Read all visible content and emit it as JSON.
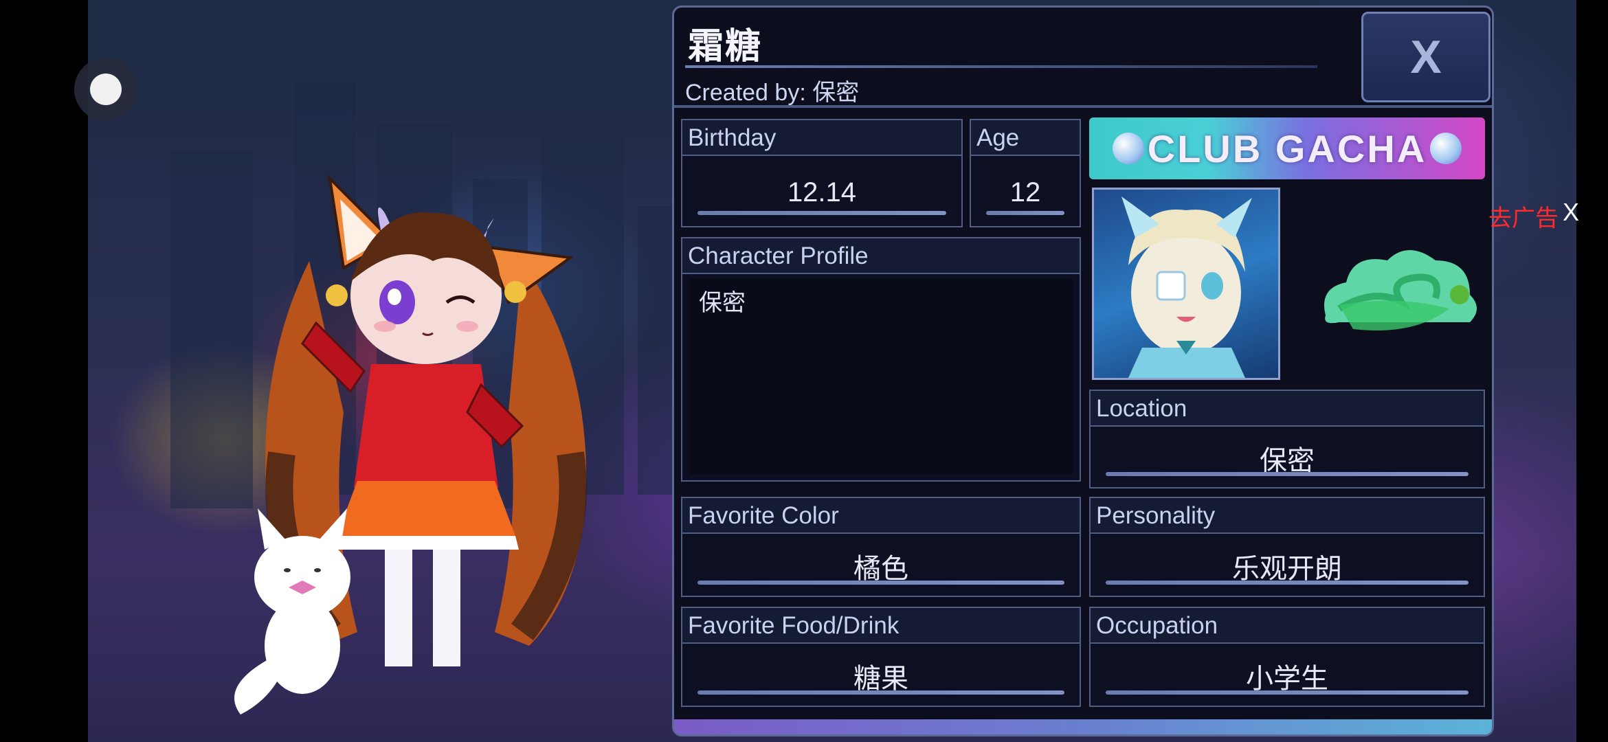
{
  "character": {
    "name": "霜糖",
    "created_by_label": "Created by:",
    "created_by": "保密"
  },
  "fields": {
    "birthday": {
      "label": "Birthday",
      "value": "12.14"
    },
    "age": {
      "label": "Age",
      "value": "12"
    },
    "profile": {
      "label": "Character Profile",
      "value": "保密"
    },
    "location": {
      "label": "Location",
      "value": "保密"
    },
    "favorite_color": {
      "label": "Favorite Color",
      "value": "橘色"
    },
    "personality": {
      "label": "Personality",
      "value": "乐观开朗"
    },
    "favorite_food": {
      "label": "Favorite Food/Drink",
      "value": "糖果"
    },
    "occupation": {
      "label": "Occupation",
      "value": "小学生"
    }
  },
  "logo": {
    "text": "CLUB GACHA"
  },
  "close_button": {
    "label": "X"
  },
  "ad": {
    "label": "去广告",
    "close": "X"
  },
  "colors": {
    "panel_bg": "#0c0e1e",
    "panel_border": "#5a6a95",
    "ad_text": "#ff2a2a",
    "logo_left": "#3ec9c9",
    "logo_right": "#d447c6"
  }
}
